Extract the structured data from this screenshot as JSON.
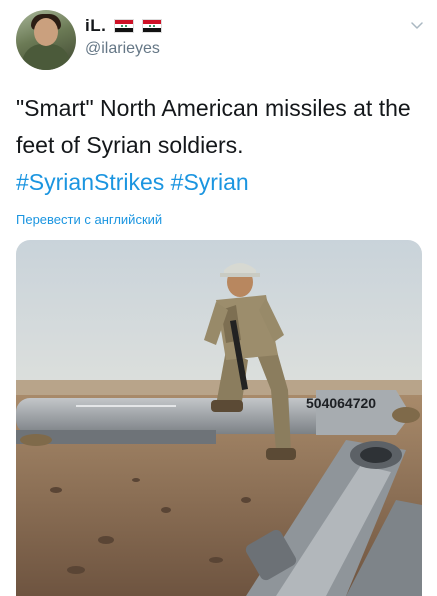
{
  "user": {
    "display_name": "iL.",
    "handle": "@ilarieyes",
    "name_emojis": [
      "syria-flag",
      "syria-flag"
    ]
  },
  "tweet": {
    "text_lines": [
      "\"Smart\" North American missiles at the",
      "feet of Syrian soldiers."
    ],
    "hashtags": [
      "#SyrianStrikes",
      "#Syrian"
    ],
    "translate_label": "Перевести с английский"
  },
  "media": {
    "missile_serial": "504064720",
    "icon": "photo"
  },
  "colors": {
    "text": "#14171a",
    "secondary": "#657786",
    "link": "#1b95e0",
    "flag_red": "#ce1126",
    "flag_green": "#007a3d"
  }
}
